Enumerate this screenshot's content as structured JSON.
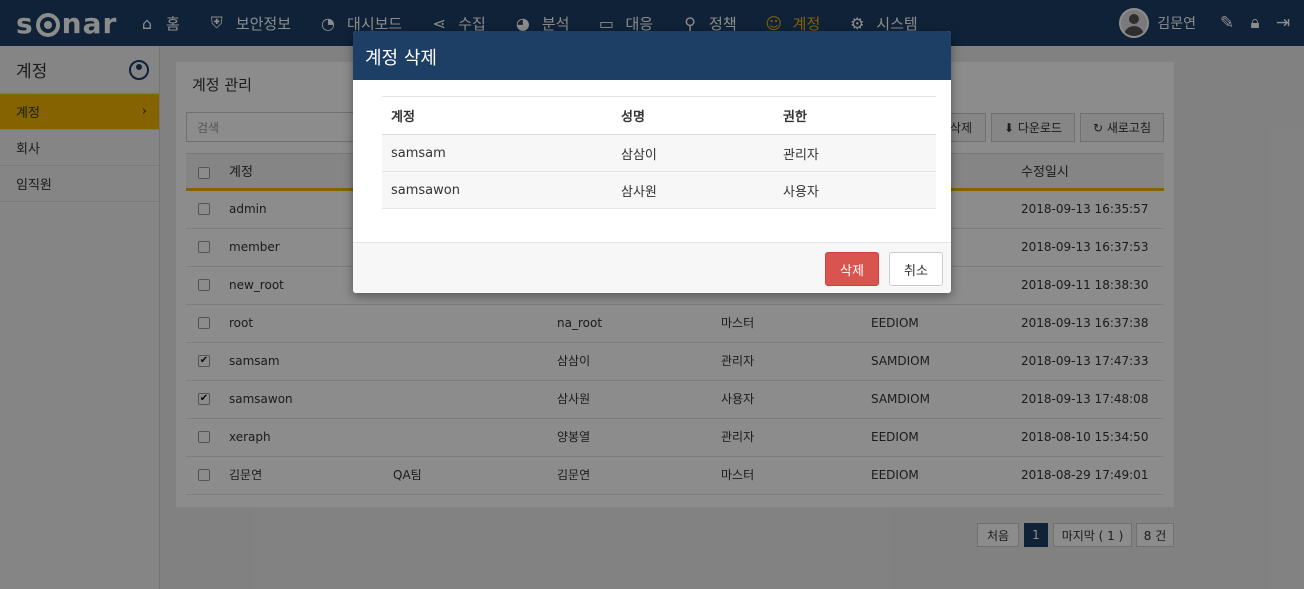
{
  "app": {
    "logo": "sonar"
  },
  "nav": {
    "items": [
      {
        "label": "홈",
        "icon": "⌂"
      },
      {
        "label": "보안정보",
        "icon": "⛨"
      },
      {
        "label": "대시보드",
        "icon": "◔"
      },
      {
        "label": "수집",
        "icon": "⋖"
      },
      {
        "label": "분석",
        "icon": "◕"
      },
      {
        "label": "대응",
        "icon": "▭"
      },
      {
        "label": "정책",
        "icon": "⚲"
      },
      {
        "label": "계정",
        "icon": "☺"
      },
      {
        "label": "시스템",
        "icon": "⚙"
      }
    ],
    "active_color": "#f0b400",
    "user_name": "김문연"
  },
  "sidebar": {
    "title": "계정",
    "items": [
      {
        "label": "계정",
        "chevron": "›"
      },
      {
        "label": "회사"
      },
      {
        "label": "임직원"
      }
    ]
  },
  "panel": {
    "title": "계정 관리",
    "search_placeholder": "검색",
    "buttons": {
      "delete": "삭제",
      "download": "⬇ 다운로드",
      "refresh": "↻ 새로고침"
    },
    "columns": {
      "account": "계정",
      "modified": "수정일시"
    },
    "rows": [
      {
        "checked": false,
        "account": "admin",
        "team": "",
        "name": "",
        "role": "",
        "company": "",
        "modified": "2018-09-13 16:35:57"
      },
      {
        "checked": false,
        "account": "member",
        "team": "",
        "name": "",
        "role": "",
        "company": "",
        "modified": "2018-09-13 16:37:53"
      },
      {
        "checked": false,
        "account": "new_root",
        "team": "",
        "name": "",
        "role": "",
        "company": "",
        "modified": "2018-09-11 18:38:30"
      },
      {
        "checked": false,
        "account": "root",
        "team": "",
        "name": "na_root",
        "role": "마스터",
        "company": "EEDIOM",
        "modified": "2018-09-13 16:37:38"
      },
      {
        "checked": true,
        "account": "samsam",
        "team": "",
        "name": "삼삼이",
        "role": "관리자",
        "company": "SAMDIOM",
        "modified": "2018-09-13 17:47:33"
      },
      {
        "checked": true,
        "account": "samsawon",
        "team": "",
        "name": "삼사원",
        "role": "사용자",
        "company": "SAMDIOM",
        "modified": "2018-09-13 17:48:08"
      },
      {
        "checked": false,
        "account": "xeraph",
        "team": "",
        "name": "양봉열",
        "role": "관리자",
        "company": "EEDIOM",
        "modified": "2018-08-10 15:34:50"
      },
      {
        "checked": false,
        "account": "김문연",
        "team": "QA팀",
        "name": "김문연",
        "role": "마스터",
        "company": "EEDIOM",
        "modified": "2018-08-29 17:49:01"
      }
    ]
  },
  "pagination": {
    "first": "처음",
    "current": "1",
    "last": "마지막 ( 1 )",
    "total": "8 건"
  },
  "modal": {
    "title": "계정 삭제",
    "columns": {
      "account": "계정",
      "name": "성명",
      "role": "권한"
    },
    "rows": [
      {
        "account": "samsam",
        "name": "삼삼이",
        "role": "관리자"
      },
      {
        "account": "samsawon",
        "name": "삼사원",
        "role": "사용자"
      }
    ],
    "delete_label": "삭제",
    "cancel_label": "취소",
    "delete_color": "#d9534f",
    "header_color": "#1d3f66"
  }
}
